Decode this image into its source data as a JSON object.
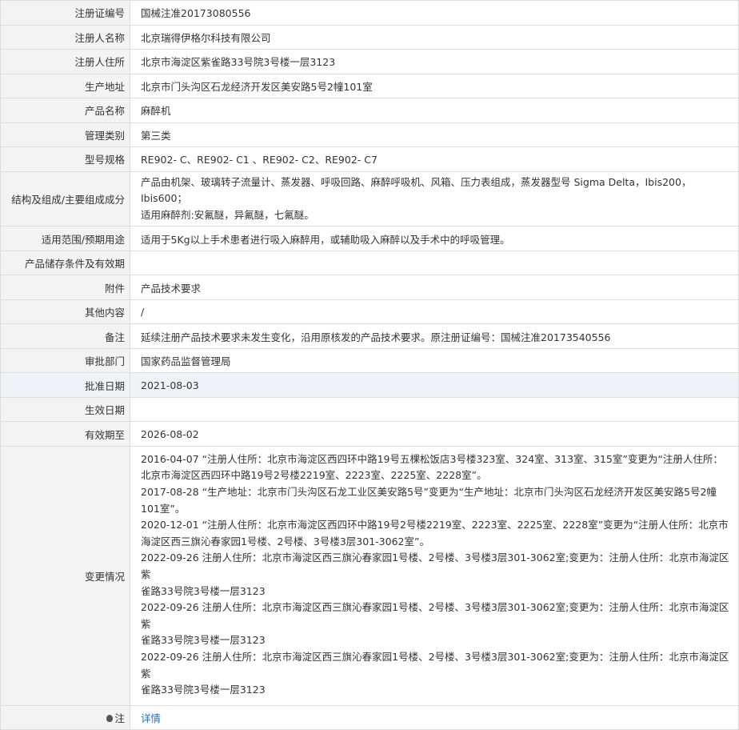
{
  "rows": {
    "reg_no": {
      "label": "注册证编号",
      "value": "国械注准20173080556"
    },
    "registrant": {
      "label": "注册人名称",
      "value": "北京瑞得伊格尔科技有限公司"
    },
    "address": {
      "label": "注册人住所",
      "value": "北京市海淀区紫雀路33号院3号楼一层3123"
    },
    "prod_addr": {
      "label": "生产地址",
      "value": "北京市门头沟区石龙经济开发区美安路5号2幢101室"
    },
    "product": {
      "label": "产品名称",
      "value": "麻醉机"
    },
    "class": {
      "label": "管理类别",
      "value": "第三类"
    },
    "model": {
      "label": "型号规格",
      "value": "RE902- C、RE902- C1 、RE902- C2、RE902- C7"
    },
    "structure": {
      "label": "结构及组成/主要组成成分",
      "line1": "产品由机架、玻璃转子流量计、蒸发器、呼吸回路、麻醉呼吸机、风箱、压力表组成，蒸发器型号 Sigma Delta，Ibis200，Ibis600；",
      "line2": "适用麻醉剂:安氟醚，异氟醚，七氟醚。"
    },
    "scope": {
      "label": "适用范围/预期用途",
      "value": "适用于5Kg以上手术患者进行吸入麻醉用，或辅助吸入麻醉以及手术中的呼吸管理。"
    },
    "storage": {
      "label": "产品储存条件及有效期",
      "value": ""
    },
    "attachment": {
      "label": "附件",
      "value": "产品技术要求"
    },
    "other": {
      "label": "其他内容",
      "value": "/"
    },
    "remark": {
      "label": "备注",
      "value": "延续注册产品技术要求未发生变化，沿用原核发的产品技术要求。原注册证编号：国械注准20173540556"
    },
    "approval_dept": {
      "label": "审批部门",
      "value": "国家药品监督管理局"
    },
    "approval_date": {
      "label": "批准日期",
      "value": "2021-08-03"
    },
    "effective_date": {
      "label": "生效日期",
      "value": ""
    },
    "valid_until": {
      "label": "有效期至",
      "value": "2026-08-02"
    },
    "changes": {
      "label": "变更情况",
      "lines": [
        "2016-04-07 “注册人住所：北京市海淀区西四环中路19号五棵松饭店3号楼323室、324室、313室、315室”变更为“注册人住所：",
        "北京市海淀区西四环中路19号2号楼2219室、2223室、2225室、2228室”。",
        "2017-08-28 “生产地址：北京市门头沟区石龙工业区美安路5号”变更为“生产地址：北京市门头沟区石龙经济开发区美安路5号2幢",
        "101室”。",
        "2020-12-01 “注册人住所：北京市海淀区西四环中路19号2号楼2219室、2223室、2225室、2228室”变更为“注册人住所：北京市",
        "海淀区西三旗沁春家园1号楼、2号楼、3号楼3层301-3062室”。",
        "2022-09-26 注册人住所：北京市海淀区西三旗沁春家园1号楼、2号楼、3号楼3层301-3062室;变更为：注册人住所：北京市海淀区紫",
        "雀路33号院3号楼一层3123",
        "2022-09-26 注册人住所：北京市海淀区西三旗沁春家园1号楼、2号楼、3号楼3层301-3062室;变更为：注册人住所：北京市海淀区紫",
        "雀路33号院3号楼一层3123",
        "2022-09-26 注册人住所：北京市海淀区西三旗沁春家园1号楼、2号楼、3号楼3层301-3062室;变更为：注册人住所：北京市海淀区紫",
        "雀路33号院3号楼一层3123"
      ]
    },
    "note": {
      "label": "注",
      "link": "详情"
    }
  },
  "icons": {
    "note_icon": "lightbulb-icon"
  }
}
